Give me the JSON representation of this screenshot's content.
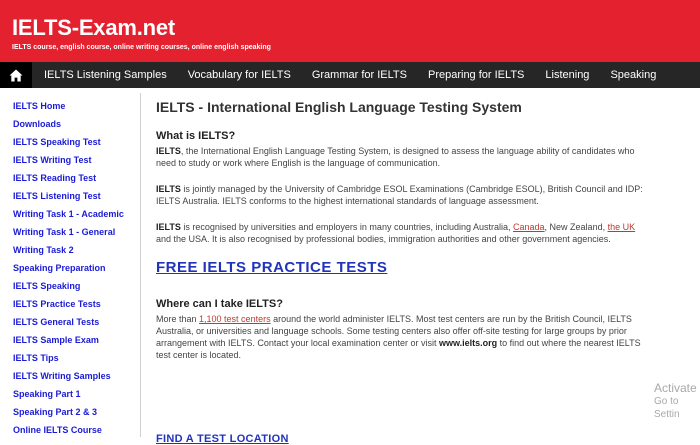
{
  "header": {
    "logo": "IELTS-Exam.net",
    "tagline": "IELTS course, english course, online writing courses, online english speaking"
  },
  "nav": {
    "home_icon": "home-icon",
    "items": [
      "IELTS Listening Samples",
      "Vocabulary for IELTS",
      "Grammar for IELTS",
      "Preparing for IELTS",
      "Listening",
      "Speaking"
    ]
  },
  "sidebar": {
    "items": [
      "IELTS Home",
      "Downloads",
      "IELTS Speaking Test",
      "IELTS Writing Test",
      "IELTS Reading Test",
      "IELTS Listening Test",
      "Writing Task 1 - Academic",
      "Writing Task 1 - General",
      "Writing Task 2",
      "Speaking Preparation",
      "IELTS Speaking",
      "IELTS Practice Tests",
      "IELTS General Tests",
      "IELTS Sample Exam",
      "IELTS Tips",
      "IELTS Writing Samples",
      "Speaking Part 1",
      "Speaking Part 2 & 3",
      "Online IELTS Course"
    ]
  },
  "main": {
    "title": "IELTS - International English Language Testing System",
    "what_heading": "What is IELTS?",
    "p1_bold": "IELTS",
    "p1_text": ", the International English Language Testing System, is designed to assess the language ability of candidates who need to study or work where English is the language of communication.",
    "p2_bold": "IELTS",
    "p2_text": " is jointly managed by the University of Cambridge ESOL Examinations (Cambridge ESOL), British Council and IDP: IELTS Australia. IELTS conforms to the highest international standards of language assessment.",
    "p3_bold": "IELTS",
    "p3_text_a": " is recognised by universities and employers in many countries, including Australia, ",
    "p3_link_canada": "Canada",
    "p3_text_b": ", New Zealand, ",
    "p3_link_uk": "the UK",
    "p3_text_c": " and the USA. It is also recognised by professional bodies, immigration authorities and other government agencies.",
    "free_tests_link": "FREE IELTS PRACTICE TESTS",
    "where_heading": "Where can I take IELTS?",
    "p4_text_a": "More than ",
    "p4_link": "1,100 test centers",
    "p4_text_b": " around the world administer IELTS. Most test centers are run by the British Council, IELTS Australia, or universities and language schools. Some testing centers also offer off-site testing for large groups by prior arrangement with IELTS. Contact your local examination center or visit ",
    "p4_bold": "www.ielts.org",
    "p4_text_c": " to find out where the nearest IELTS test center is located.",
    "find_link": "FIND A TEST LOCATION"
  },
  "watermark": {
    "line1": "Activate",
    "line2": "Go to Settin"
  }
}
